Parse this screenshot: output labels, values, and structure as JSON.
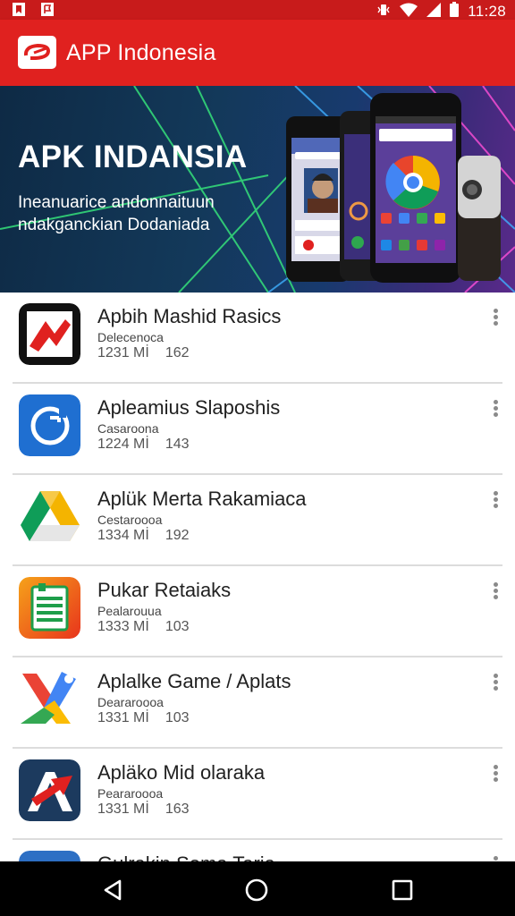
{
  "status_bar": {
    "time": "11:28",
    "left_icons": [
      "notification-bookmark-icon",
      "notification-flag-icon"
    ],
    "right_icons": [
      "vibrate-icon",
      "wifi-icon",
      "signal-icon",
      "battery-icon"
    ]
  },
  "app_bar": {
    "title": "APP Indonesia",
    "logo_icon": "app-logo-icon",
    "color": "#e0211f"
  },
  "banner": {
    "title": "APK INDANSIA",
    "subtitle": "Ineanuarice andonnaituun ndakganckian Dodaniada"
  },
  "apps": [
    {
      "name": "Apbih Mashid Rasics",
      "developer": "Delecenoca",
      "size": "1231 Mİ",
      "rating": "162",
      "icon": "red-arrow-app-icon"
    },
    {
      "name": "Apleamius Slaposhis",
      "developer": "Casaroona",
      "size": "1224 Mİ",
      "rating": "143",
      "icon": "blue-refresh-app-icon"
    },
    {
      "name": "Aplük Merta Rakamiaca",
      "developer": "Cestaroooa",
      "size": "1334 Mİ",
      "rating": "192",
      "icon": "drive-triangle-app-icon"
    },
    {
      "name": "Pukar Retaiaks",
      "developer": "Pealarouua",
      "size": "1333 Mİ",
      "rating": "103",
      "icon": "green-document-app-icon"
    },
    {
      "name": "Aplalke Game / Aplats",
      "developer": "Deararoooa",
      "size": "1331 Mİ",
      "rating": "103",
      "icon": "multicolor-x-app-icon"
    },
    {
      "name": "Apläko Mid olaraka",
      "developer": "Peararoooa",
      "size": "1331 Mİ",
      "rating": "163",
      "icon": "red-arrow-dark-app-icon"
    },
    {
      "name": "Gulrakin Soma Taria",
      "developer": "",
      "size": "",
      "rating": "",
      "icon": "blue-wave-app-icon"
    }
  ],
  "nav_bar": {
    "buttons": [
      "back-icon",
      "home-icon",
      "recents-icon"
    ]
  }
}
